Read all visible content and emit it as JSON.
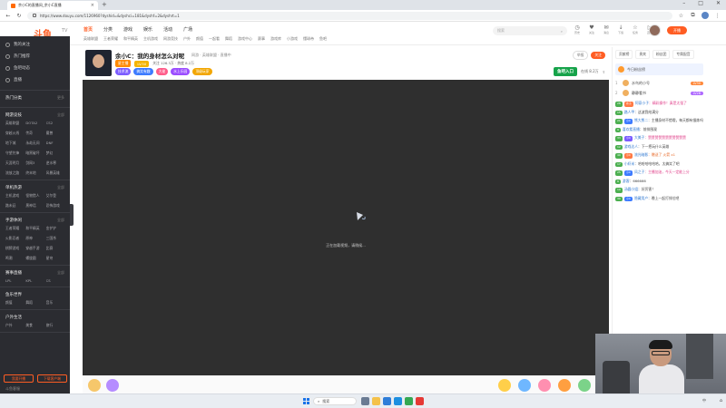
{
  "browser": {
    "tab_title": "余小C的直播间_余小C直播",
    "url": "https://www.douyu.com/1126960?dyshid=&dyshci=181&dyshf=2&dyshrt=1",
    "new_tab": "+",
    "back": "←",
    "refresh": "↻",
    "win_min": "–",
    "win_max": "□",
    "win_close": "✕"
  },
  "site": {
    "logo": "斗鱼",
    "logo_sub": "TV",
    "nav": [
      "首页",
      "分类",
      "游戏",
      "娱乐",
      "活动",
      "广场"
    ],
    "subnav": [
      "英雄联盟",
      "王者荣耀",
      "和平精英",
      "主机游戏",
      "网游竞技",
      "户外",
      "颜值",
      "一起看",
      "舞蹈",
      "游戏中心",
      "赛事",
      "游戏库",
      "小游戏",
      "懂球帝",
      "鱼吧"
    ],
    "search_placeholder": "搜索",
    "header_icons": [
      {
        "icon": "history-icon",
        "glyph": "◷",
        "label": "历史"
      },
      {
        "icon": "follow-icon",
        "glyph": "♥",
        "label": "关注"
      },
      {
        "icon": "message-icon",
        "glyph": "✉",
        "label": "消息"
      },
      {
        "icon": "download-icon",
        "glyph": "↓",
        "label": "下载"
      },
      {
        "icon": "task-icon",
        "glyph": "☆",
        "label": "任务"
      },
      {
        "icon": "live-icon",
        "glyph": "▷",
        "label": "直播"
      }
    ],
    "open_button": "开播"
  },
  "sidebar": {
    "top_items": [
      "我的关注",
      "热门推荐",
      "鱼吧动态",
      "直播"
    ],
    "sections": [
      {
        "title": "热门分类",
        "more": "更多",
        "items": []
      },
      {
        "title": "网游竞技",
        "more": "全部",
        "items": [
          "英雄联盟",
          "DOTA2",
          "CS2",
          "穿越火线",
          "传奇",
          "魔兽",
          "地下城",
          "永劫无间",
          "DNF",
          "守望先锋",
          "暗黑破坏",
          "梦幻",
          "天涯明月",
          "剑网3",
          "逆水寒",
          "流放之路",
          "终末地",
          "风暴英雄"
        ]
      },
      {
        "title": "单机热游",
        "more": "全部",
        "items": [
          "主机游戏",
          "怪物猎人",
          "艾尔登",
          "路未廷",
          "黑神话",
          "恐怖游戏"
        ]
      },
      {
        "title": "手游休闲",
        "more": "全部",
        "items": [
          "王者荣耀",
          "和平精英",
          "金铲铲",
          "火影忍者",
          "原神",
          "三国杀",
          "棋牌游戏",
          "穿越手游",
          "比赛",
          "鸣潮",
          "螺旋圆",
          "星穹"
        ]
      },
      {
        "title": "赛事直播",
        "more": "全部",
        "items": [
          "LPL",
          "KPL",
          "CS"
        ]
      },
      {
        "title": "鱼乐世界",
        "more": "",
        "items": [
          "颜值",
          "舞蹈",
          "音乐"
        ]
      },
      {
        "title": "户外生活",
        "more": "",
        "items": [
          "户外",
          "美食",
          "旅行"
        ]
      }
    ],
    "bottom_buttons": [
      "我要开播",
      "下载客户端"
    ],
    "footer": "斗鱼客服"
  },
  "room": {
    "title": "余小C：我的身材怎么对呢",
    "meta": "网游 · 英雄联盟 · 直播中",
    "line2_badges": [
      "星主播",
      "LV.50"
    ],
    "line2_text": "关注 126.3万 · 热度 8.2万",
    "tags": [
      "技术流",
      "搞笑有趣",
      "大佬",
      "水上乐园",
      "顶级玩家"
    ],
    "right_pills": [
      "举报",
      "关注"
    ],
    "promo": "鱼吧入口",
    "right_stats": "在线 8.2万"
  },
  "player": {
    "loading_text": "正在加载视频，请稍候..."
  },
  "chat": {
    "top_buttons": [
      "贡献榜",
      "贵宾",
      "粉丝团",
      "专属配音"
    ],
    "banner": "今日粉丝榜",
    "ranks": [
      {
        "n": "1",
        "name": "水鸟的小号",
        "lv": "LV30",
        "color": "#ff8a3d"
      },
      {
        "n": "2",
        "name": "静静看书",
        "lv": "LV28",
        "color": "#b06bff"
      }
    ],
    "messages": [
      {
        "lvl": "28",
        "fans": "水子",
        "nick": "阿豪小子",
        "text": "精彩操作！真是太强了",
        "kind": "colorful"
      },
      {
        "lvl": "15",
        "fans": "",
        "nick": "路人甲",
        "text": "这波我给满分",
        "kind": ""
      },
      {
        "lvl": "21",
        "fans": "小C",
        "nick": "熊大熊二",
        "text": "主播身材不错哦，每天都有锻炼吗",
        "kind": ""
      },
      {
        "lvl": "9",
        "fans": "",
        "nick": "喜欢看直播",
        "text": "前排围观",
        "kind": ""
      },
      {
        "lvl": "33",
        "fans": "小C",
        "nick": "大美子",
        "text": "赞赞赞赞赞赞赞赞赞赞赞",
        "kind": "colorful"
      },
      {
        "lvl": "12",
        "fans": "",
        "nick": "游戏达人",
        "text": "下一把玩什么英雄",
        "kind": ""
      },
      {
        "lvl": "40",
        "fans": "小C",
        "nick": "流光暗影",
        "text": "赠送了 火箭 x1",
        "kind": "sys"
      },
      {
        "lvl": "17",
        "fans": "",
        "nick": "小虾米",
        "text": "哈哈哈哈哈哈，太搞笑了吧",
        "kind": ""
      },
      {
        "lvl": "25",
        "fans": "小C",
        "nick": "风之子",
        "text": "主播加油，今天一定能上分",
        "kind": "colorful"
      },
      {
        "lvl": "8",
        "fans": "",
        "nick": "游客",
        "text": "666666",
        "kind": ""
      },
      {
        "lvl": "19",
        "fans": "",
        "nick": "汤圆小姐",
        "text": "好厉害！",
        "kind": ""
      },
      {
        "lvl": "30",
        "fans": "小C",
        "nick": "隐藏用户",
        "text": "晚上一起打排位吧",
        "kind": ""
      }
    ]
  },
  "taskbar": {
    "search": "搜索",
    "tray": "中",
    "tray_icons": "⌂"
  },
  "colors": {
    "accent": "#ff5d23",
    "sidebar_bg": "#2b2c31",
    "player_bg": "#2f2f2f"
  }
}
